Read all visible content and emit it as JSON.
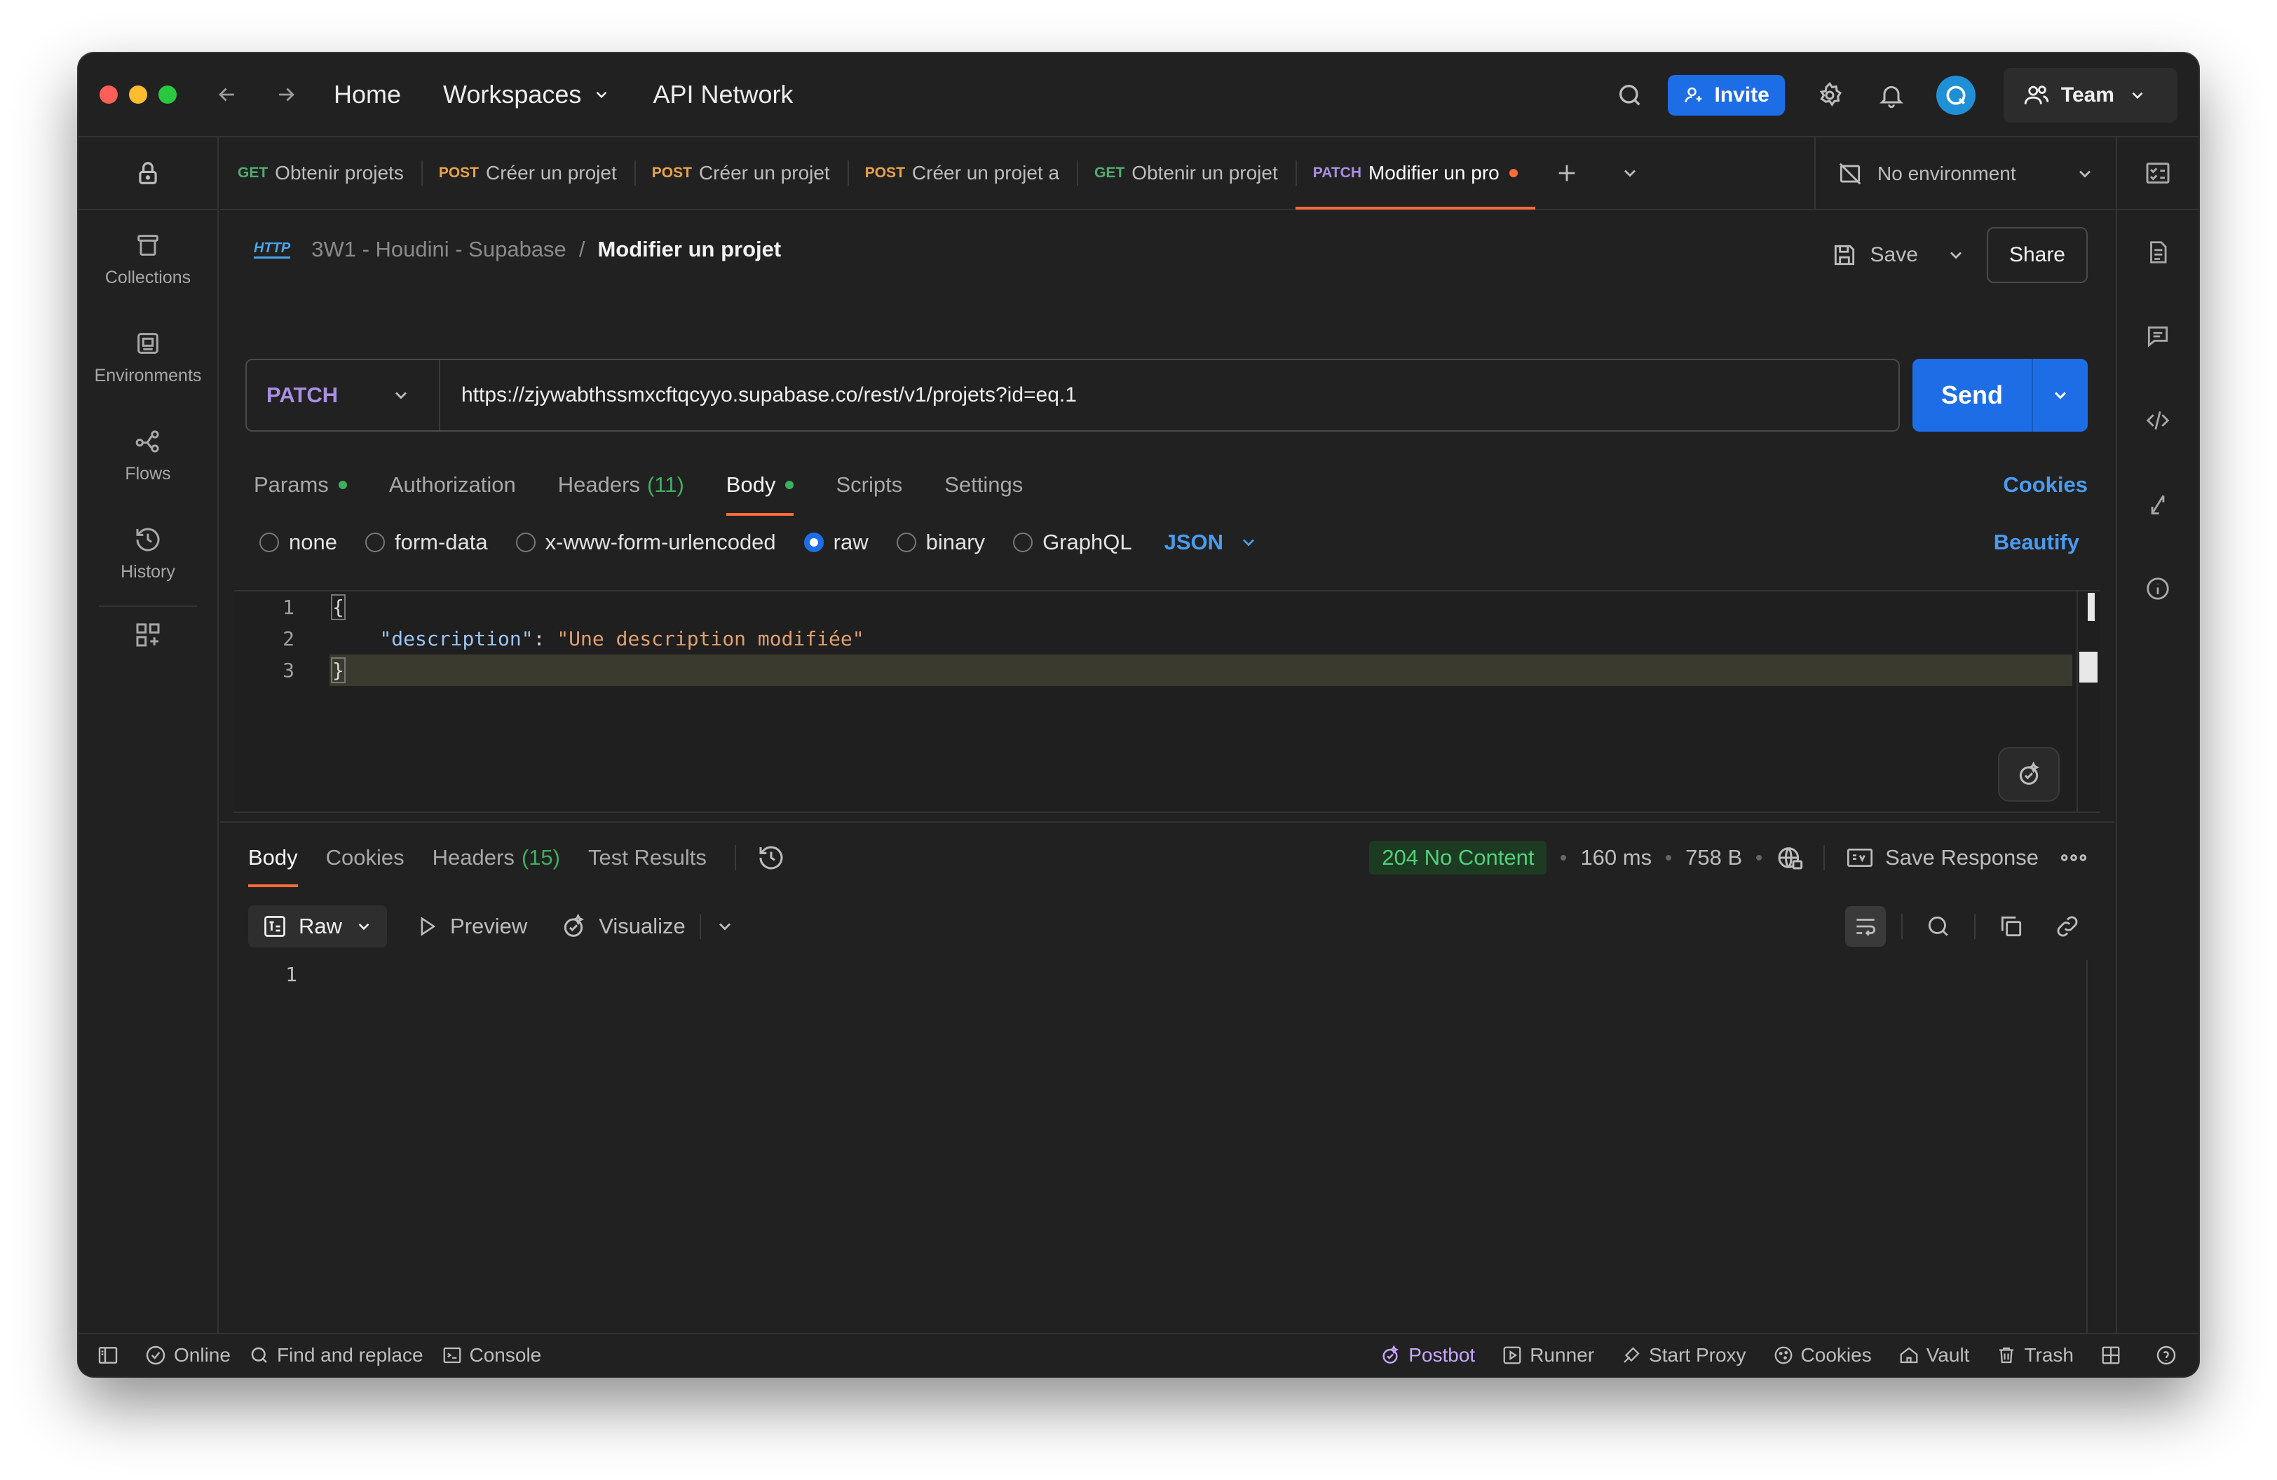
{
  "nav": {
    "home": "Home",
    "workspaces": "Workspaces",
    "api_network": "API Network",
    "invite": "Invite",
    "team": "Team"
  },
  "sidebar": {
    "items": [
      {
        "label": "Collections",
        "icon": "trash-can-icon"
      },
      {
        "label": "Environments",
        "icon": "environment-icon"
      },
      {
        "label": "Flows",
        "icon": "flows-icon"
      },
      {
        "label": "History",
        "icon": "history-icon"
      }
    ]
  },
  "tabs": [
    {
      "method": "GET",
      "label": "Obtenir projets"
    },
    {
      "method": "POST",
      "label": "Créer un projet"
    },
    {
      "method": "POST",
      "label": "Créer un projet"
    },
    {
      "method": "POST",
      "label": "Créer un projet a"
    },
    {
      "method": "GET",
      "label": "Obtenir un projet"
    },
    {
      "method": "PATCH",
      "label": "Modifier un pro",
      "active": true,
      "unsaved": true
    }
  ],
  "environment": "No environment",
  "breadcrumb": {
    "protocol": "HTTP",
    "collection": "3W1 - Houdini - Supabase",
    "separator": "/",
    "request": "Modifier un projet"
  },
  "actions": {
    "save": "Save",
    "share": "Share"
  },
  "request": {
    "method": "PATCH",
    "url": "https://zjywabthssmxcftqcyyo.supabase.co/rest/v1/projets?id=eq.1",
    "send": "Send"
  },
  "req_tabs": {
    "params": "Params",
    "authorization": "Authorization",
    "headers": "Headers",
    "headers_count": "(11)",
    "body": "Body",
    "scripts": "Scripts",
    "settings": "Settings",
    "cookies": "Cookies"
  },
  "body_types": {
    "none": "none",
    "form_data": "form-data",
    "urlencoded": "x-www-form-urlencoded",
    "raw": "raw",
    "binary": "binary",
    "graphql": "GraphQL",
    "format": "JSON",
    "beautify": "Beautify",
    "selected": "raw"
  },
  "editor": {
    "line_numbers": [
      "1",
      "2",
      "3"
    ],
    "open_brace": "{",
    "key": "\"description\"",
    "colon": ": ",
    "value": "\"Une description modifiée\"",
    "close_brace": "}"
  },
  "response": {
    "tabs": {
      "body": "Body",
      "cookies": "Cookies",
      "headers": "Headers",
      "headers_count": "(15)",
      "test_results": "Test Results"
    },
    "status": "204 No Content",
    "time": "160 ms",
    "size": "758 B",
    "save_response": "Save Response",
    "raw": "Raw",
    "preview": "Preview",
    "visualize": "Visualize",
    "line_number": "1"
  },
  "statusbar": {
    "online": "Online",
    "find_replace": "Find and replace",
    "console": "Console",
    "postbot": "Postbot",
    "runner": "Runner",
    "start_proxy": "Start Proxy",
    "cookies": "Cookies",
    "vault": "Vault",
    "trash": "Trash"
  },
  "colors": {
    "accent": "#ff6c37",
    "primary_blue": "#1d6ee6",
    "get": "#4fae73",
    "post": "#e8a34a",
    "patch": "#a98fe3",
    "success": "#4fd27a"
  }
}
